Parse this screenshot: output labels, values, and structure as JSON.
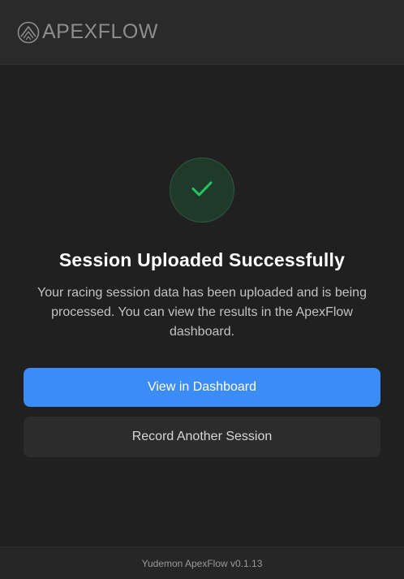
{
  "header": {
    "logo_text": "APEXFLOW",
    "logo_icon": "apexflow-logo-icon"
  },
  "main": {
    "status_icon": "check-icon",
    "title": "Session Uploaded Successfully",
    "description": "Your racing session data has been uploaded and is being processed. You can view the results in the ApexFlow dashboard.",
    "primary_button_label": "View in Dashboard",
    "secondary_button_label": "Record Another Session"
  },
  "footer": {
    "version_text": "Yudemon ApexFlow v0.1.13"
  },
  "colors": {
    "background": "#202020",
    "header": "#2a2a2a",
    "accent": "#3b8cf6",
    "success": "#22c55e"
  }
}
